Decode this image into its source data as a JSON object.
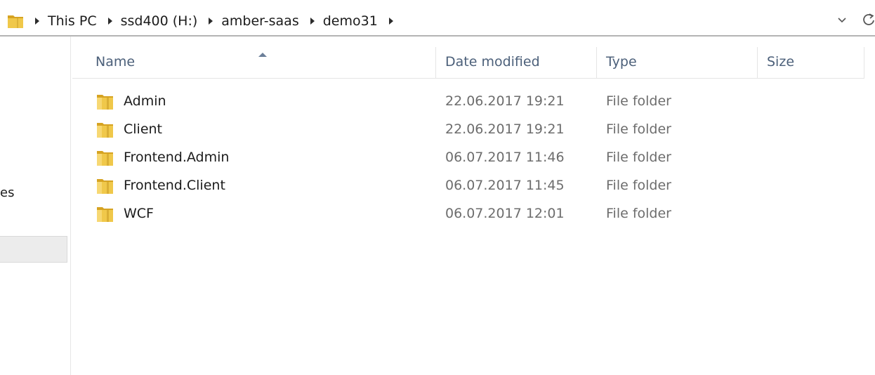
{
  "colors": {
    "folder_yellow": "#f0c84a",
    "folder_dark": "#d6a322",
    "header_text": "#4c607a",
    "secondary_text": "#6d6d6d",
    "selected_bg": "#ececec"
  },
  "address_bar": {
    "folder_icon": "folder-icon",
    "crumbs": [
      "This PC",
      "ssd400 (H:)",
      "amber-saas",
      "demo31"
    ],
    "dropdown_icon": "chevron-down-icon",
    "refresh_icon": "refresh-icon"
  },
  "nav": {
    "partial_item_label": "es"
  },
  "columns": {
    "name": "Name",
    "date_modified": "Date modified",
    "type": "Type",
    "size": "Size",
    "sort_icon": "sort-ascending-icon"
  },
  "files": [
    {
      "name": "Admin",
      "date": "22.06.2017 19:21",
      "type": "File folder",
      "size": ""
    },
    {
      "name": "Client",
      "date": "22.06.2017 19:21",
      "type": "File folder",
      "size": ""
    },
    {
      "name": "Frontend.Admin",
      "date": "06.07.2017 11:46",
      "type": "File folder",
      "size": ""
    },
    {
      "name": "Frontend.Client",
      "date": "06.07.2017 11:45",
      "type": "File folder",
      "size": ""
    },
    {
      "name": "WCF",
      "date": "06.07.2017 12:01",
      "type": "File folder",
      "size": ""
    }
  ]
}
